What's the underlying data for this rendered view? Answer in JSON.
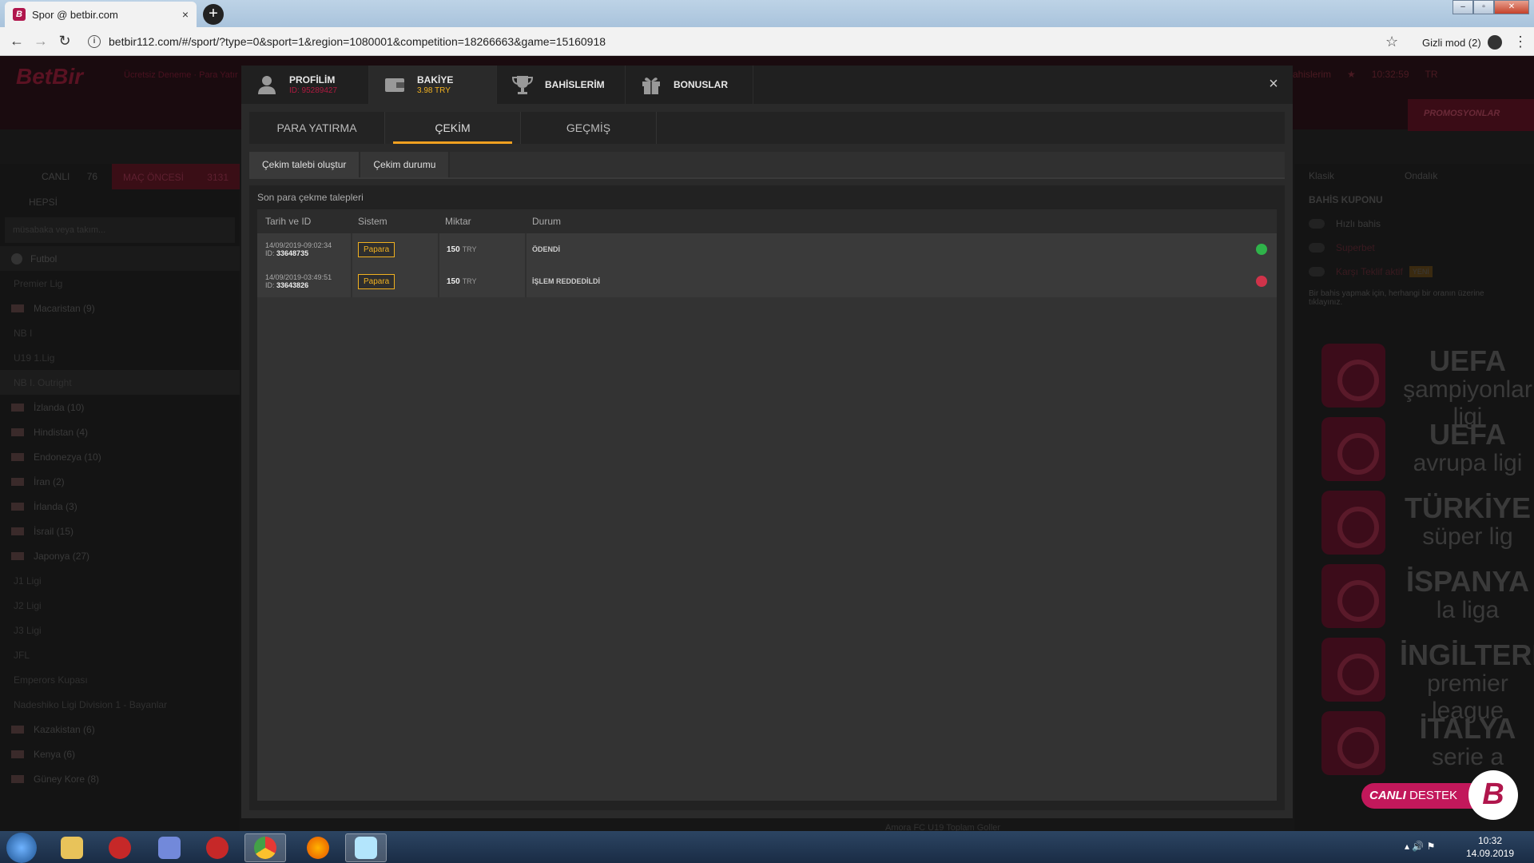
{
  "browser": {
    "tab_title": "Spor @ betbir.com",
    "favicon_letter": "B",
    "tab_close": "×",
    "new_tab": "+",
    "url": "betbir112.com/#/sport/?type=0&sport=1&region=1080001&competition=18266663&game=15160918",
    "incognito_label": "Gizli mod (2)",
    "window_buttons": [
      "–",
      "▫",
      "✕"
    ]
  },
  "site": {
    "logo": "BetBir",
    "header_links": "Ücretsiz Deneme · Para Yatır",
    "header_right": [
      "Bahislerim",
      "★",
      "10:32:59",
      "TR"
    ],
    "promo": "PROMOSYONLAR"
  },
  "left_panel": {
    "tab_live": "CANLI",
    "tab_live_count": "76",
    "tab_prematch": "MAÇ ÖNCESİ",
    "tab_prematch_count": "3131",
    "filter": "HEPSİ",
    "search_placeholder": "müsabaka veya takım...",
    "sport": "Futbol",
    "rows": [
      {
        "label": "Premier Lig",
        "type": "sub"
      },
      {
        "label": "Macaristan (9)",
        "type": "country"
      },
      {
        "label": "NB I",
        "type": "sub"
      },
      {
        "label": "U19 1.Lig",
        "type": "sub"
      },
      {
        "label": "NB I. Outright",
        "type": "sub-hl"
      },
      {
        "label": "İzlanda (10)",
        "type": "country"
      },
      {
        "label": "Hindistan (4)",
        "type": "country"
      },
      {
        "label": "Endonezya (10)",
        "type": "country"
      },
      {
        "label": "İran (2)",
        "type": "country"
      },
      {
        "label": "İrlanda (3)",
        "type": "country"
      },
      {
        "label": "İsrail (15)",
        "type": "country"
      },
      {
        "label": "Japonya (27)",
        "type": "country"
      },
      {
        "label": "J1 Ligi",
        "type": "sub"
      },
      {
        "label": "J2 Ligi",
        "type": "sub"
      },
      {
        "label": "J3 Ligi",
        "type": "sub"
      },
      {
        "label": "JFL",
        "type": "sub"
      },
      {
        "label": "Emperors Kupası",
        "type": "sub"
      },
      {
        "label": "Nadeshiko Ligi Division 1 - Bayanlar",
        "type": "sub"
      },
      {
        "label": "Kazakistan (6)",
        "type": "country"
      },
      {
        "label": "Kenya (6)",
        "type": "country"
      },
      {
        "label": "Güney Kore (8)",
        "type": "country"
      }
    ]
  },
  "right_panel": {
    "select_1": "Klasik",
    "select_2": "Ondalık",
    "coupon_title": "BAHİS KUPONU",
    "options": [
      "Hızlı bahis",
      "Superbet",
      "Karşı Teklif aktif"
    ],
    "new_badge": "YENİ",
    "hint": "Bir bahis yapmak için, herhangi bir oranın üzerine tıklayınız.",
    "leagues": [
      {
        "name": "UEFA",
        "sub": "şampiyonlar ligi"
      },
      {
        "name": "UEFA",
        "sub": "avrupa ligi"
      },
      {
        "name": "TÜRKİYE",
        "sub": "süper lig"
      },
      {
        "name": "İSPANYA",
        "sub": "la liga"
      },
      {
        "name": "İNGİLTERE",
        "sub": "premier league"
      },
      {
        "name": "İTALYA",
        "sub": "serie a"
      }
    ]
  },
  "modal": {
    "tabs": [
      {
        "label": "PROFİLİM",
        "sub": "ID: 95289427",
        "icon": "user-icon"
      },
      {
        "label": "BAKİYE",
        "sub": "3.98 TRY",
        "icon": "wallet-icon"
      },
      {
        "label": "BAHİSLERİM",
        "sub": "",
        "icon": "trophy-icon"
      },
      {
        "label": "BONUSLAR",
        "sub": "",
        "icon": "gift-icon"
      }
    ],
    "close": "×",
    "subtabs": [
      "PARA YATIRMA",
      "ÇEKİM",
      "GEÇMİŞ"
    ],
    "actions": [
      "Çekim talebi oluştur",
      "Çekim durumu"
    ],
    "content_title": "Son para çekme talepleri",
    "table": {
      "headers": [
        "Tarih ve ID",
        "Sistem",
        "Miktar",
        "Durum"
      ],
      "rows": [
        {
          "date": "14/09/2019-09:02:34",
          "id_label": "ID:",
          "id": "33648735",
          "system": "Papara",
          "amount": "150",
          "currency": "TRY",
          "status": "ÖDENDİ",
          "status_type": "ok"
        },
        {
          "date": "14/09/2019-03:49:51",
          "id_label": "ID:",
          "id": "33643826",
          "system": "Papara",
          "amount": "150",
          "currency": "TRY",
          "status": "İŞLEM REDDEDİLDİ",
          "status_type": "no"
        }
      ]
    }
  },
  "bottom_text": "Amora FC U19 Toplam Goller",
  "support": {
    "bold": "CANLI",
    "text": "DESTEK",
    "logo": "B"
  },
  "taskbar": {
    "time": "10:32",
    "date": "14.09.2019"
  },
  "colors": {
    "accent": "#f0a020",
    "brand": "#b0164c",
    "ok": "#2fb34a",
    "error": "#d0334a"
  }
}
